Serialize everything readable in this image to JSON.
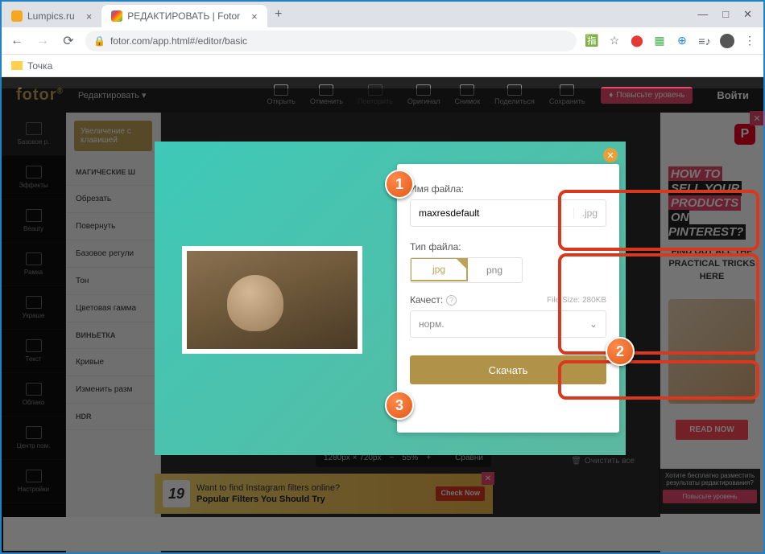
{
  "browser": {
    "tabs": [
      {
        "title": "Lumpics.ru",
        "favicon": "#f5a623"
      },
      {
        "title": "РЕДАКТИРОВАТЬ | Fotor",
        "favicon": "#4285f4"
      }
    ],
    "url": "fotor.com/app.html#/editor/basic",
    "bookmark": "Точка"
  },
  "topbar": {
    "logo": "fotor",
    "edit": "Редактировать",
    "menu": [
      "Открыть",
      "Отменить",
      "Повторить",
      "Оригинал",
      "Снимок",
      "Поделиться",
      "Сохранить"
    ],
    "upgrade": "Повысьте уровень",
    "login": "Войти"
  },
  "sidebar": [
    "Эффекты",
    "Beauty",
    "Рамка",
    "Украше",
    "Текст",
    "Облако",
    "Центр пом.",
    "Настройки"
  ],
  "panel": {
    "zoom_hint": "Увеличение с клавишей",
    "items": [
      "МАГИЧЕСКИЕ Ш",
      "Обрезать",
      "Повернуть",
      "Базовое регули",
      "Тон",
      "Цветовая гамма",
      "ВИНЬЕТКА",
      "Кривые",
      "Изменить разм",
      "HDR"
    ]
  },
  "export": {
    "filename_label": "Имя файла:",
    "filename_value": "maxresdefault",
    "ext": ".jpg",
    "filetype_label": "Тип файла:",
    "type_jpg": "jpg",
    "type_png": "png",
    "quality_label": "Качест:",
    "file_size": "File Size: 280KB",
    "quality_value": "норм.",
    "download": "Скачать"
  },
  "bottom": {
    "dims": "1280px × 720px",
    "zoom": "55%",
    "compare": "Сравни",
    "reset": "Очистить все"
  },
  "ad_right": {
    "h1": "HOW TO",
    "h2": "SELL YOUR",
    "h3": "PRODUCTS",
    "h4": "ON PINTEREST?",
    "sub": "FIND OUT ALL THE PRACTICAL TRICKS HERE",
    "cta": "READ NOW"
  },
  "ad_banner": {
    "num": "19",
    "l1": "Want to find Instagram filters online?",
    "l2": "Popular Filters You Should Try",
    "cta": "Check Now"
  },
  "promo": {
    "text": "Хотите бесплатно разместить результаты редактирования?",
    "btn": "Повысьте уровень"
  },
  "annotations": {
    "n1": "1",
    "n2": "2",
    "n3": "3"
  }
}
